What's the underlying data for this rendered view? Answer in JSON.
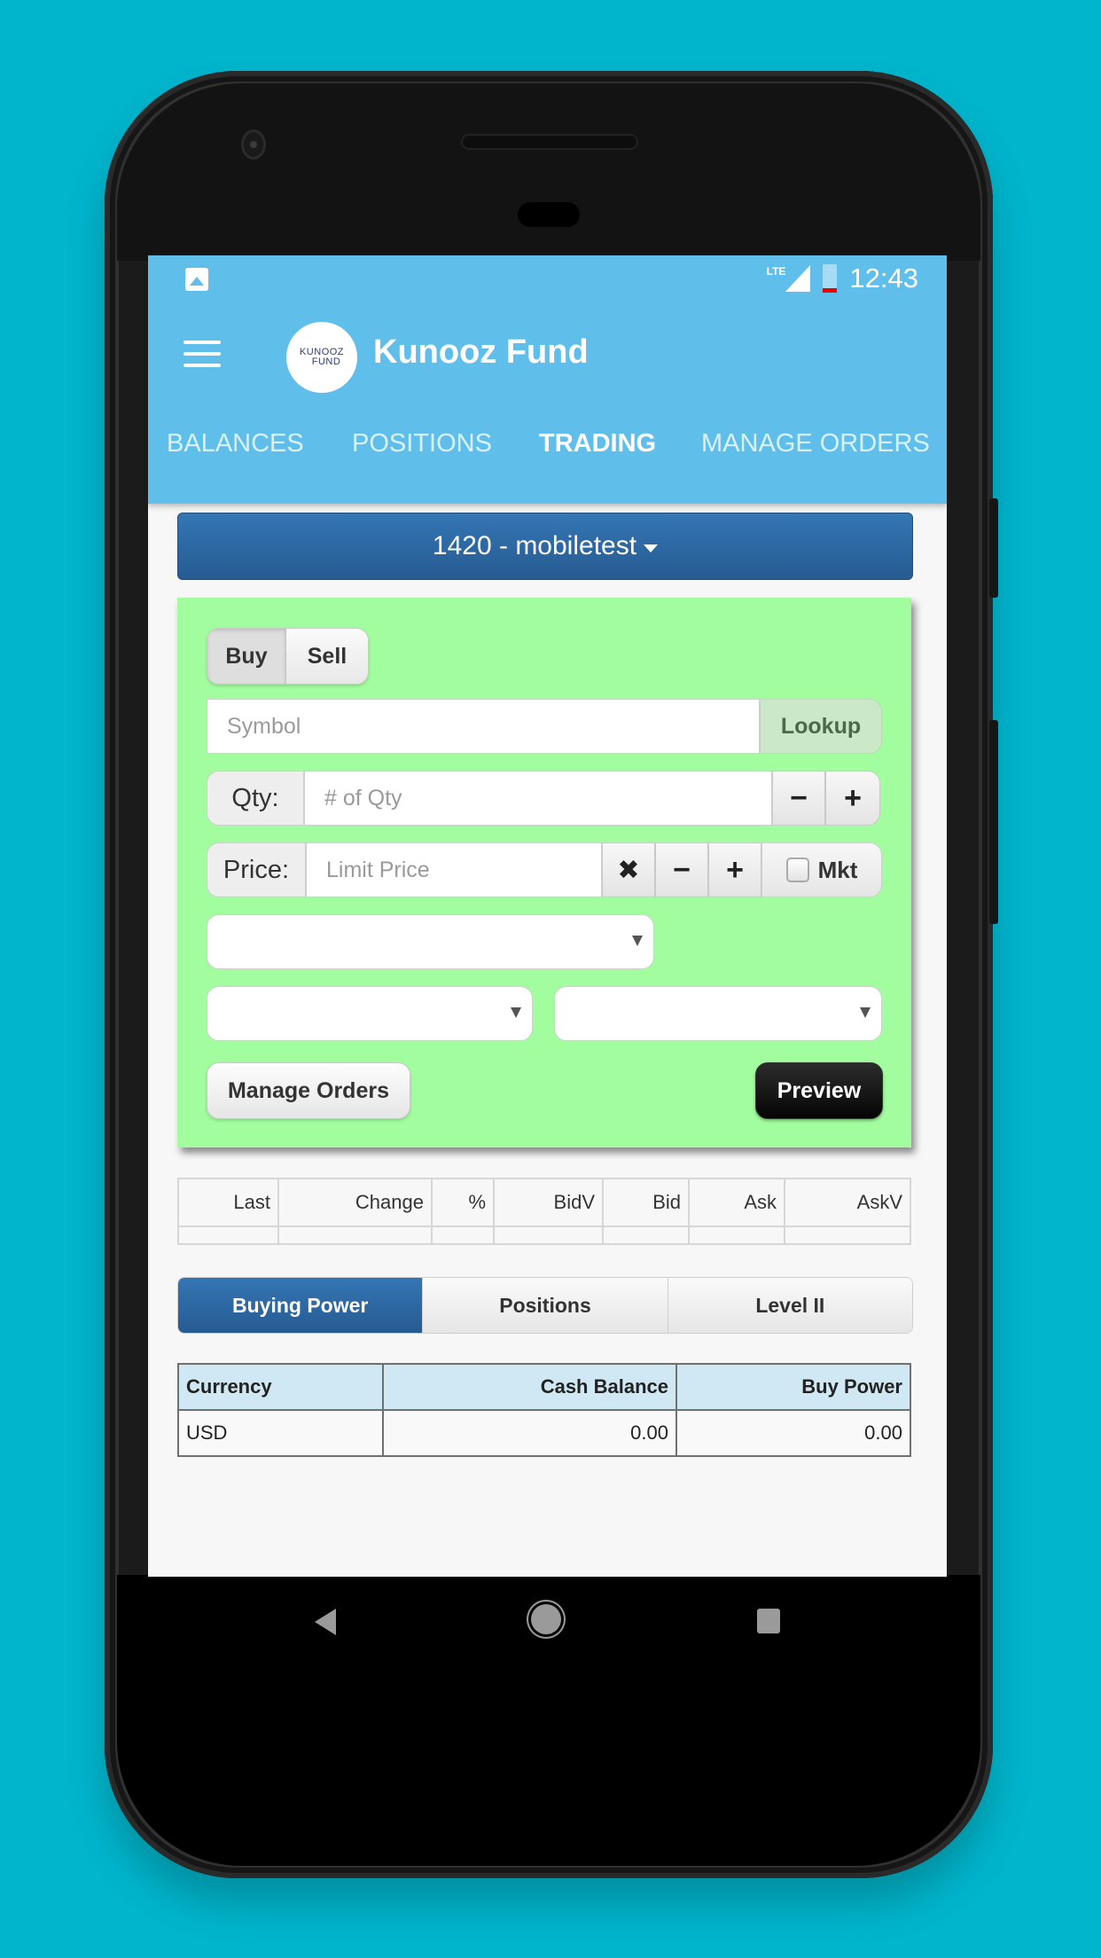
{
  "status_bar": {
    "network": "LTE",
    "time": "12:43",
    "icons": [
      "gallery-icon",
      "signal-icon",
      "battery-icon"
    ]
  },
  "app": {
    "title": "Kunooz Fund",
    "logo_text_line1": "KUNOOZ",
    "logo_text_line2": "FUND",
    "brand_color": "#5fbfea"
  },
  "tabs": [
    {
      "label": "BALANCES",
      "active": false
    },
    {
      "label": "POSITIONS",
      "active": false
    },
    {
      "label": "TRADING",
      "active": true
    },
    {
      "label": "MANAGE ORDERS",
      "active": false
    }
  ],
  "account": {
    "selected": "1420 - mobiletest"
  },
  "order_form": {
    "side_buy": "Buy",
    "side_sell": "Sell",
    "side_selected": "Buy",
    "symbol_placeholder": "Symbol",
    "symbol_value": "",
    "lookup_label": "Lookup",
    "qty_label": "Qty:",
    "qty_placeholder": "# of Qty",
    "qty_value": "",
    "minus_glyph": "−",
    "plus_glyph": "+",
    "clear_glyph": "✖",
    "price_label": "Price:",
    "price_placeholder": "Limit Price",
    "price_value": "",
    "mkt_label": "Mkt",
    "mkt_checked": false,
    "order_type_value": "",
    "duration_value": "",
    "route_value": "",
    "manage_orders_label": "Manage Orders",
    "preview_label": "Preview",
    "card_color": "#a1fd9e"
  },
  "quote_table": {
    "headers": [
      "Last",
      "Change",
      "%",
      "BidV",
      "Bid",
      "Ask",
      "AskV"
    ],
    "rows": [
      [
        "",
        "",
        "",
        "",
        "",
        "",
        ""
      ]
    ]
  },
  "bottom_tabs": [
    {
      "label": "Buying Power",
      "active": true
    },
    {
      "label": "Positions",
      "active": false
    },
    {
      "label": "Level II",
      "active": false
    }
  ],
  "buying_power": {
    "headers": [
      "Currency",
      "Cash Balance",
      "Buy Power"
    ],
    "rows": [
      [
        "USD",
        "0.00",
        "0.00"
      ]
    ]
  },
  "nav": {
    "back": "back-icon",
    "home": "home-icon",
    "recents": "recents-icon"
  }
}
